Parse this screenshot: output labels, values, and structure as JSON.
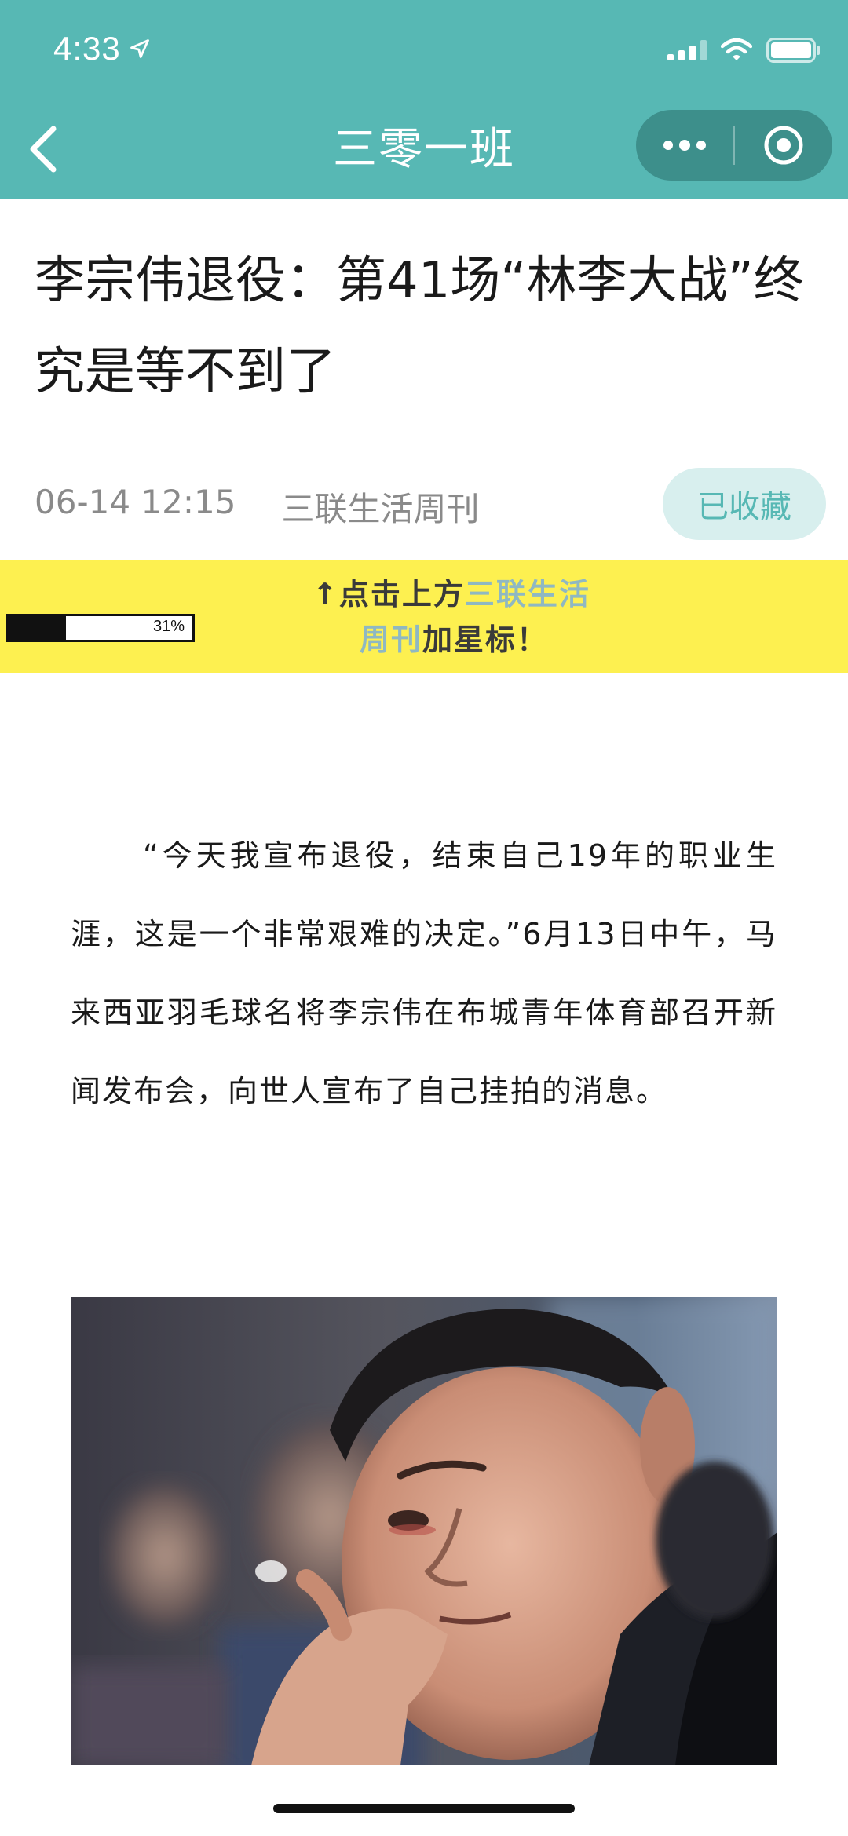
{
  "status": {
    "time": "4:33",
    "location_icon": "location-arrow-icon",
    "signal_icon": "cellular-signal-icon",
    "wifi_icon": "wifi-icon",
    "battery_icon": "battery-icon"
  },
  "nav": {
    "title": "三零一班",
    "back_icon": "chevron-left-icon",
    "more_icon": "more-dots-icon",
    "close_icon": "target-close-icon"
  },
  "article": {
    "title": "李宗伟退役：第41场“林李大战”终究是等不到了",
    "date": "06-14 12:15",
    "source": "三联生活周刊",
    "favorite_label": "已收藏"
  },
  "banner": {
    "prefix": "↑点击上方",
    "highlight_a": "三联生活",
    "highlight_b": "周刊",
    "suffix": "加星标！"
  },
  "progress": {
    "value": 0.31,
    "label": "31%"
  },
  "body": {
    "paragraph": "“今天我宣布退役，结束自己19年的职业生涯，这是一个非常艰难的决定。”6月13日中午，马来西亚羽毛球名将李宗伟在布城青年体育部召开新闻发布会，向世人宣布了自己挂拍的消息。"
  },
  "colors": {
    "accent": "#57b8b4",
    "banner": "#fdf050",
    "highlight": "#8fb8c2"
  }
}
